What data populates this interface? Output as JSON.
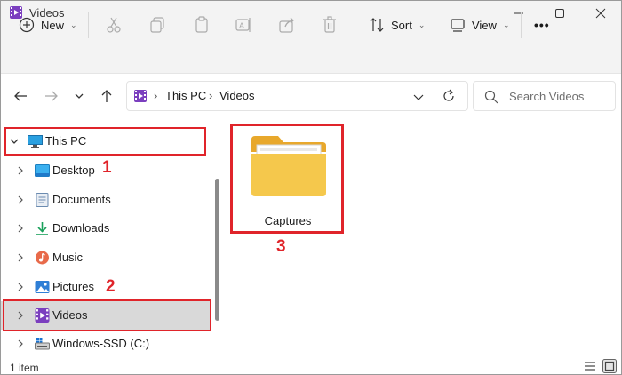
{
  "window": {
    "title": "Videos"
  },
  "toolbar": {
    "new_label": "New",
    "sort_label": "Sort",
    "view_label": "View",
    "more_label": "•••"
  },
  "address": {
    "crumbs": [
      "This PC",
      "Videos"
    ],
    "search_placeholder": "Search Videos"
  },
  "sidebar": {
    "items": [
      {
        "label": "This PC",
        "icon": "monitor-icon"
      },
      {
        "label": "Desktop",
        "icon": "desktop-icon"
      },
      {
        "label": "Documents",
        "icon": "documents-icon"
      },
      {
        "label": "Downloads",
        "icon": "downloads-icon"
      },
      {
        "label": "Music",
        "icon": "music-icon"
      },
      {
        "label": "Pictures",
        "icon": "pictures-icon"
      },
      {
        "label": "Videos",
        "icon": "videos-icon"
      },
      {
        "label": "Windows-SSD (C:)",
        "icon": "drive-icon"
      }
    ]
  },
  "content": {
    "items": [
      {
        "label": "Captures",
        "icon": "folder-icon"
      }
    ]
  },
  "status": {
    "count": "1 item"
  },
  "annotations": {
    "labels": [
      "1",
      "2",
      "3"
    ]
  },
  "colors": {
    "accent_red": "#e0242a",
    "selection": "#d9d9d9",
    "folder": "#f5c84c"
  }
}
